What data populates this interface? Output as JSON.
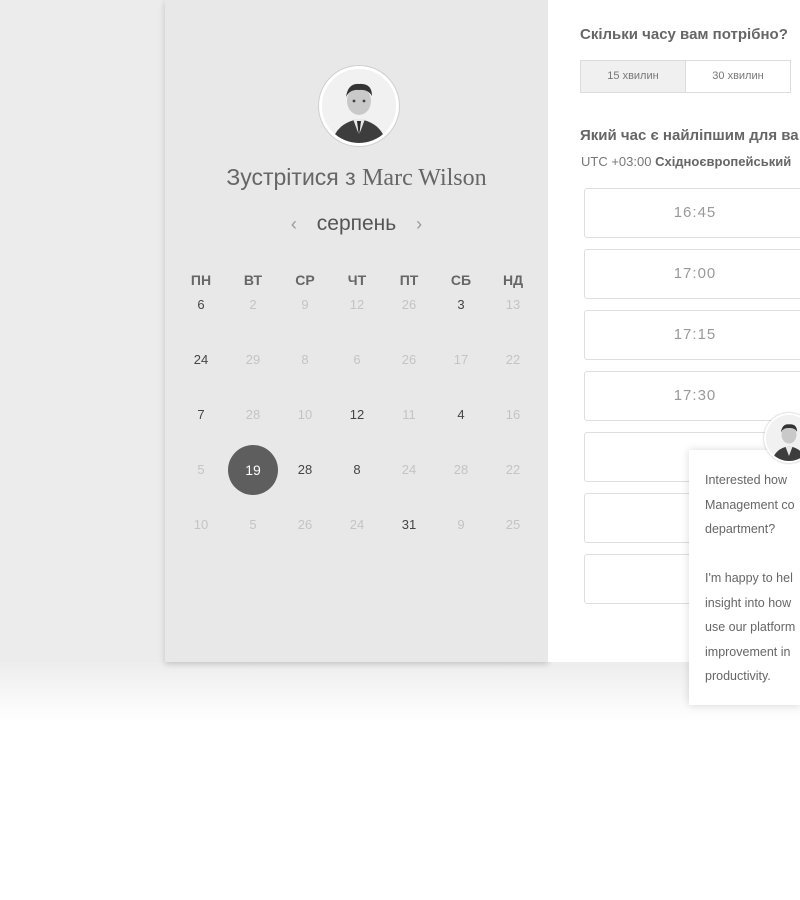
{
  "host": {
    "title_prefix": "Зустрітися з",
    "name": "Marc Wilson"
  },
  "calendar": {
    "month": "серпень",
    "prev_icon": "‹",
    "next_icon": "›",
    "weekdays": [
      "ПН",
      "ВТ",
      "СР",
      "ЧТ",
      "ПТ",
      "СБ",
      "НД"
    ],
    "weeks": [
      [
        "6",
        "2",
        "9",
        "12",
        "26",
        "3",
        "13"
      ],
      [
        "24",
        "29",
        "8",
        "6",
        "26",
        "17",
        "22"
      ],
      [
        "7",
        "28",
        "10",
        "12",
        "11",
        "4",
        "16"
      ],
      [
        "5",
        "19",
        "28",
        "8",
        "24",
        "28",
        "22"
      ],
      [
        "10",
        "5",
        "26",
        "24",
        "31",
        "9",
        "25"
      ]
    ],
    "selected_day": "19"
  },
  "duration": {
    "question": "Скільки часу вам потрібно?",
    "options": [
      "15 хвилин",
      "30 хвилин"
    ]
  },
  "time": {
    "question": "Який час є найліпшим для ва",
    "tz_offset": "UTC +03:00",
    "tz_name": "Східноєвропейський",
    "slots": [
      "16:45",
      "17:00",
      "17:15",
      "17:30",
      "",
      "",
      "",
      ""
    ]
  },
  "chat": {
    "lines": [
      "Interested how",
      "Management co",
      "department?",
      "",
      "I'm happy to hel",
      "insight into how",
      "use our platform",
      "improvement in",
      "productivity."
    ]
  }
}
